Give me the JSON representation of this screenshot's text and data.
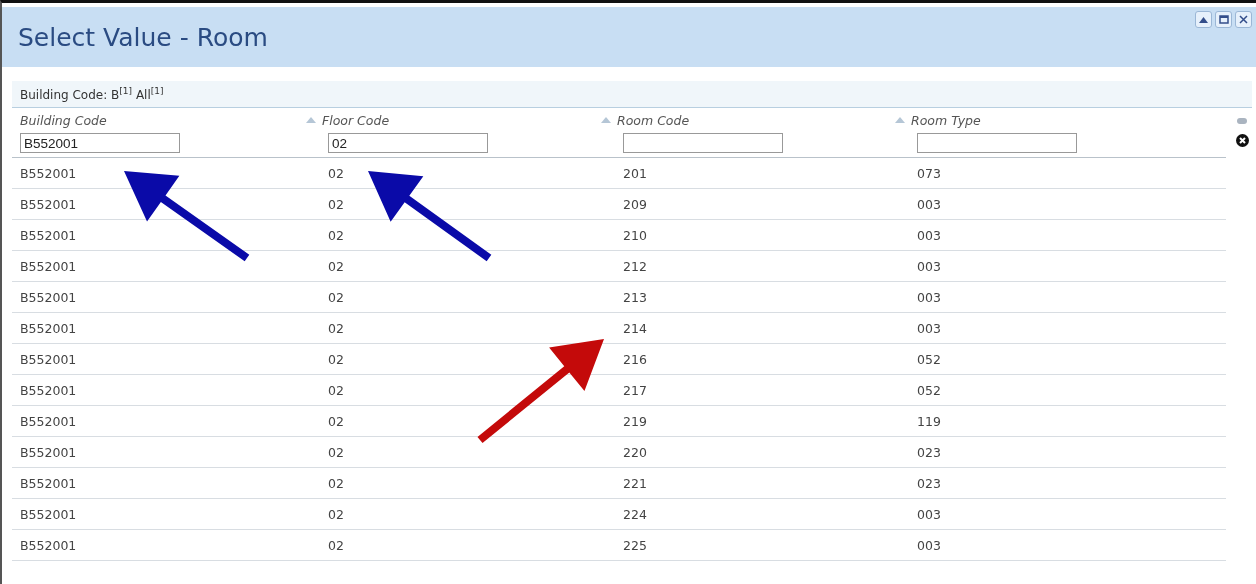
{
  "window": {
    "title": "Select Value - Room"
  },
  "filter_summary": "Building Code: B$^{[1]}$ All$^{[1]}$",
  "table": {
    "columns": [
      {
        "label": "Building Code",
        "filter": "B552001"
      },
      {
        "label": "Floor Code",
        "filter": "02"
      },
      {
        "label": "Room Code"
      },
      {
        "label": "Room Type"
      }
    ],
    "rows": [
      [
        "B552001",
        "02",
        "201",
        "073"
      ],
      [
        "B552001",
        "02",
        "209",
        "003"
      ],
      [
        "B552001",
        "02",
        "210",
        "003"
      ],
      [
        "B552001",
        "02",
        "212",
        "003"
      ],
      [
        "B552001",
        "02",
        "213",
        "003"
      ],
      [
        "B552001",
        "02",
        "214",
        "003"
      ],
      [
        "B552001",
        "02",
        "216",
        "052"
      ],
      [
        "B552001",
        "02",
        "217",
        "052"
      ],
      [
        "B552001",
        "02",
        "219",
        "119"
      ],
      [
        "B552001",
        "02",
        "220",
        "023"
      ],
      [
        "B552001",
        "02",
        "221",
        "023"
      ],
      [
        "B552001",
        "02",
        "224",
        "003"
      ],
      [
        "B552001",
        "02",
        "225",
        "003"
      ]
    ]
  },
  "annotations": [
    {
      "kind": "arrow",
      "color": "#0a0aa8"
    },
    {
      "kind": "arrow",
      "color": "#0a0aa8"
    },
    {
      "kind": "arrow",
      "color": "#c40a0a"
    }
  ]
}
